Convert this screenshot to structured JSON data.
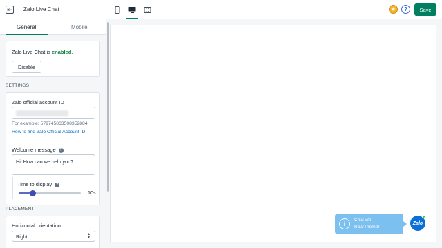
{
  "app": {
    "title": "Zalo Live Chat",
    "back_icon": "back-arrow-icon",
    "save_label": "Save",
    "accent_color": "#008060"
  },
  "device_toggle": {
    "items": [
      {
        "name": "mobile",
        "icon": "mobile-icon",
        "active": false
      },
      {
        "name": "desktop",
        "icon": "desktop-icon",
        "active": true
      },
      {
        "name": "fullscreen",
        "icon": "fullscreen-icon",
        "active": false
      }
    ]
  },
  "toolbar": {
    "star_icon": "star-icon",
    "help_icon": "help-icon",
    "help_glyph": "?"
  },
  "sidebar": {
    "tabs": [
      {
        "label": "General",
        "active": true
      },
      {
        "label": "Mobile",
        "active": false
      }
    ],
    "status": {
      "prefix": "Zalo Live Chat is ",
      "state": "enabled",
      "suffix": ".",
      "button_label": "Disable"
    },
    "settings": {
      "section_label": "SETTINGS",
      "account_id": {
        "label": "Zalo official account ID",
        "value": "",
        "help": "For example: 579745863508352884",
        "link": "How to find Zalo Official Account ID"
      },
      "welcome": {
        "label": "Welcome message",
        "value": "Hi! How can we help you?"
      },
      "time_to_display": {
        "label": "Time to display",
        "value_label": "10s",
        "fraction": 0.22
      }
    },
    "placement": {
      "section_label": "PLACEMENT",
      "horizontal": {
        "label": "Horizontal orientation",
        "value": "Right"
      }
    }
  },
  "preview": {
    "bubble_line1": "Chat với",
    "bubble_line2": "RoarTheme!",
    "bubble_color": "#7cc0ef",
    "zalo_label": "Zalo",
    "zalo_color": "#0a6fd6"
  }
}
